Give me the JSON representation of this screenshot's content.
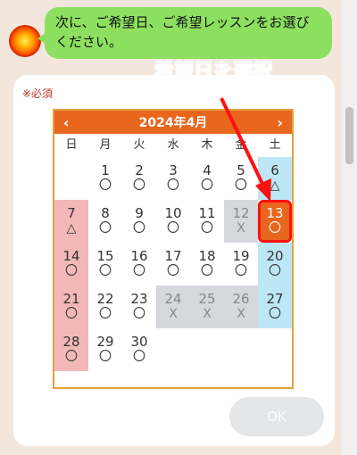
{
  "chat": {
    "message": "次に、ご希望日、ご希望レッスンをお選びください。"
  },
  "form": {
    "required_label": "※必須",
    "annotation": "希望日を選択",
    "ok_label": "OK"
  },
  "calendar": {
    "prev_label": "‹",
    "next_label": "›",
    "title": "2024年4月",
    "weekdays": [
      "日",
      "月",
      "火",
      "水",
      "木",
      "金",
      "土"
    ],
    "weeks": [
      [
        {
          "day": "",
          "mark": "",
          "status": "empty"
        },
        {
          "day": "1",
          "mark": "〇",
          "status": "open"
        },
        {
          "day": "2",
          "mark": "〇",
          "status": "open"
        },
        {
          "day": "3",
          "mark": "〇",
          "status": "open"
        },
        {
          "day": "4",
          "mark": "〇",
          "status": "open"
        },
        {
          "day": "5",
          "mark": "〇",
          "status": "open"
        },
        {
          "day": "6",
          "mark": "△",
          "status": "open"
        }
      ],
      [
        {
          "day": "7",
          "mark": "△",
          "status": "open"
        },
        {
          "day": "8",
          "mark": "〇",
          "status": "open"
        },
        {
          "day": "9",
          "mark": "〇",
          "status": "open"
        },
        {
          "day": "10",
          "mark": "〇",
          "status": "open"
        },
        {
          "day": "11",
          "mark": "〇",
          "status": "open"
        },
        {
          "day": "12",
          "mark": "X",
          "status": "full"
        },
        {
          "day": "13",
          "mark": "〇",
          "status": "selected"
        }
      ],
      [
        {
          "day": "14",
          "mark": "〇",
          "status": "open"
        },
        {
          "day": "15",
          "mark": "〇",
          "status": "open"
        },
        {
          "day": "16",
          "mark": "〇",
          "status": "open"
        },
        {
          "day": "17",
          "mark": "〇",
          "status": "open"
        },
        {
          "day": "18",
          "mark": "〇",
          "status": "open"
        },
        {
          "day": "19",
          "mark": "〇",
          "status": "open"
        },
        {
          "day": "20",
          "mark": "〇",
          "status": "open"
        }
      ],
      [
        {
          "day": "21",
          "mark": "〇",
          "status": "open"
        },
        {
          "day": "22",
          "mark": "〇",
          "status": "open"
        },
        {
          "day": "23",
          "mark": "〇",
          "status": "open"
        },
        {
          "day": "24",
          "mark": "X",
          "status": "full"
        },
        {
          "day": "25",
          "mark": "X",
          "status": "full"
        },
        {
          "day": "26",
          "mark": "X",
          "status": "full"
        },
        {
          "day": "27",
          "mark": "〇",
          "status": "open"
        }
      ],
      [
        {
          "day": "28",
          "mark": "〇",
          "status": "open"
        },
        {
          "day": "29",
          "mark": "〇",
          "status": "open"
        },
        {
          "day": "30",
          "mark": "〇",
          "status": "open"
        },
        {
          "day": "",
          "mark": "",
          "status": "empty"
        },
        {
          "day": "",
          "mark": "",
          "status": "empty"
        },
        {
          "day": "",
          "mark": "",
          "status": "empty"
        },
        {
          "day": "",
          "mark": "",
          "status": "empty"
        }
      ]
    ]
  },
  "colors": {
    "accent": "#e8661e",
    "bubble": "#8de05f",
    "sunday": "#f2b8b8",
    "saturday": "#bde7f5",
    "full": "#d5d8dc",
    "highlight": "#ff1010"
  }
}
